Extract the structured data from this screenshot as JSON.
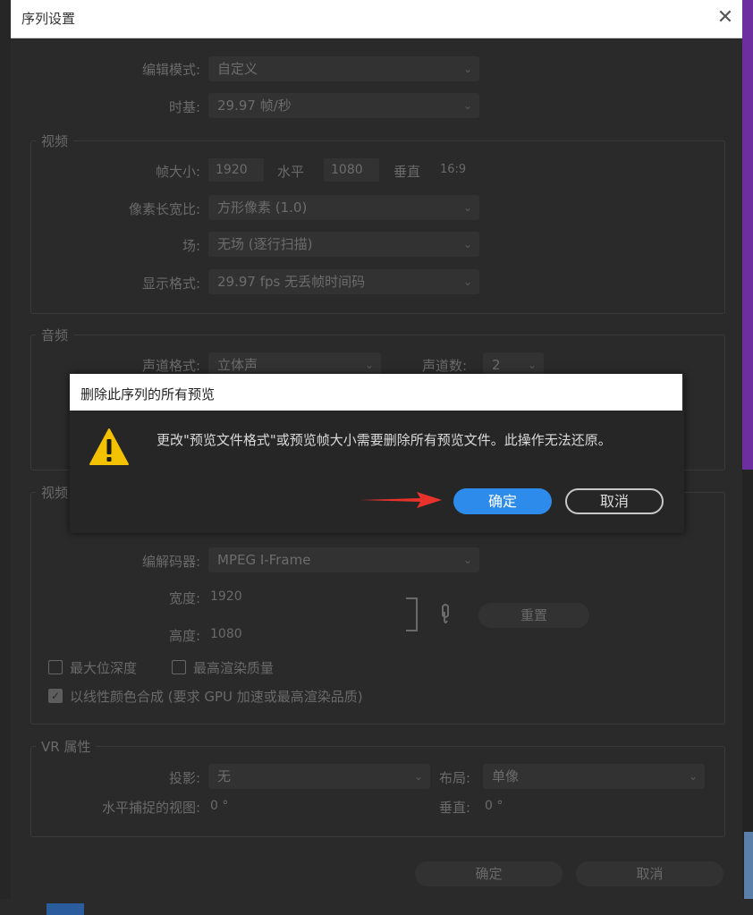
{
  "window": {
    "title": "序列设置"
  },
  "general": {
    "edit_mode_label": "编辑模式:",
    "edit_mode_value": "自定义",
    "timebase_label": "时基:",
    "timebase_value": "29.97  帧/秒"
  },
  "video": {
    "group_title": "视频",
    "frame_size_label": "帧大小:",
    "frame_width": "1920",
    "horizontal_label": "水平",
    "frame_height": "1080",
    "vertical_label": "垂直",
    "aspect": "16:9",
    "pixel_aspect_label": "像素长宽比:",
    "pixel_aspect_value": "方形像素 (1.0)",
    "fields_label": "场:",
    "fields_value": "无场 (逐行扫描)",
    "display_format_label": "显示格式:",
    "display_format_value": "29.97 fps 无丢帧时间码"
  },
  "audio": {
    "group_title": "音频",
    "channel_format_label": "声道格式:",
    "channel_format_value": "立体声",
    "channel_count_label": "声道数:",
    "channel_count_value": "2"
  },
  "preview": {
    "group_title": "视频",
    "codec_label": "编解码器:",
    "codec_value": "MPEG I-Frame",
    "width_label": "宽度:",
    "width_value": "1920",
    "height_label": "高度:",
    "height_value": "1080",
    "reset_label": "重置",
    "max_bit_depth_label": "最大位深度",
    "max_render_quality_label": "最高渲染质量",
    "linear_color_label": "以线性颜色合成 (要求 GPU 加速或最高渲染品质)"
  },
  "vr": {
    "group_title": "VR 属性",
    "projection_label": "投影:",
    "projection_value": "无",
    "layout_label": "布局:",
    "layout_value": "单像",
    "h_view_label": "水平捕捉的视图:",
    "h_view_value": "0 °",
    "v_label": "垂直:",
    "v_value": "0 °"
  },
  "footer": {
    "ok_label": "确定",
    "cancel_label": "取消"
  },
  "alert": {
    "title": "删除此序列的所有预览",
    "message": "更改\"预览文件格式\"或预览帧大小需要删除所有预览文件。此操作无法还原。",
    "ok_label": "确定",
    "cancel_label": "取消"
  },
  "colors": {
    "primary_button": "#2d8ceb",
    "warning_icon": "#f2c200",
    "arrow": "#e8322c"
  }
}
